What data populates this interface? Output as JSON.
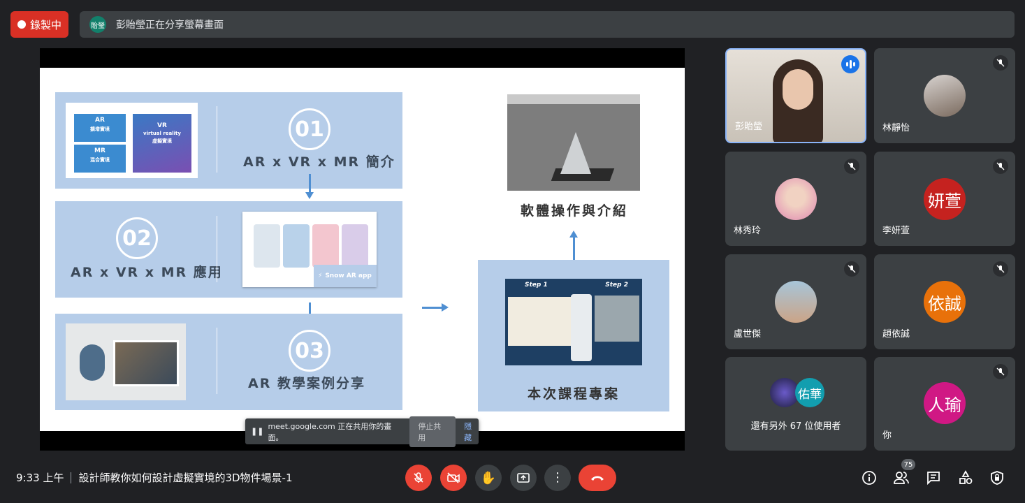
{
  "top": {
    "recording_label": "錄製中",
    "presenter_initials": "貽瑩",
    "presenting_text": "彭貽瑩正在分享螢幕畫面"
  },
  "slide": {
    "sections": [
      {
        "number": "01",
        "title": "AR x VR x MR 簡介"
      },
      {
        "number": "02",
        "title": "AR x VR x MR 應用"
      },
      {
        "number": "03",
        "title": "AR 教學案例分享"
      }
    ],
    "thumb1": {
      "ar": "AR",
      "ar_sub": "擴增實境",
      "mr": "MR",
      "mr_sub": "混合實境",
      "vr": "VR",
      "vr_en": "virtual reality",
      "vr_sub": "虛擬實境"
    },
    "thumb2": {
      "app_label": "Snow AR app"
    },
    "software_title": "軟體操作與介紹",
    "project": {
      "step1": "Step 1",
      "step2": "Step 2",
      "title": "本次課程專案"
    }
  },
  "share_notice": {
    "text": "meet.google.com 正在共用你的畫面。",
    "stop_label": "停止共用",
    "hide_label": "隱藏"
  },
  "participants": [
    {
      "name": "彭貽瑩",
      "speaking": true
    },
    {
      "name": "林靜怡",
      "muted": true
    },
    {
      "name": "林秀玲",
      "muted": true
    },
    {
      "name": "李妍萱",
      "initials": "妍萱",
      "color": "#c5221f",
      "muted": true
    },
    {
      "name": "盧世傑",
      "muted": true
    },
    {
      "name": "趙依誠",
      "initials": "依誠",
      "color": "#e8710a",
      "muted": true
    },
    {
      "others_label": "還有另外 67 位使用者",
      "initials": "佑華",
      "color": "#129eaf"
    },
    {
      "name": "你",
      "initials": "人瑜",
      "color": "#d01884",
      "muted": true
    }
  ],
  "bottom": {
    "time": "9:33 上午",
    "meeting_title": "設計師教你如何設計虛擬實境的3D物件場景-1",
    "participant_count": "75"
  }
}
